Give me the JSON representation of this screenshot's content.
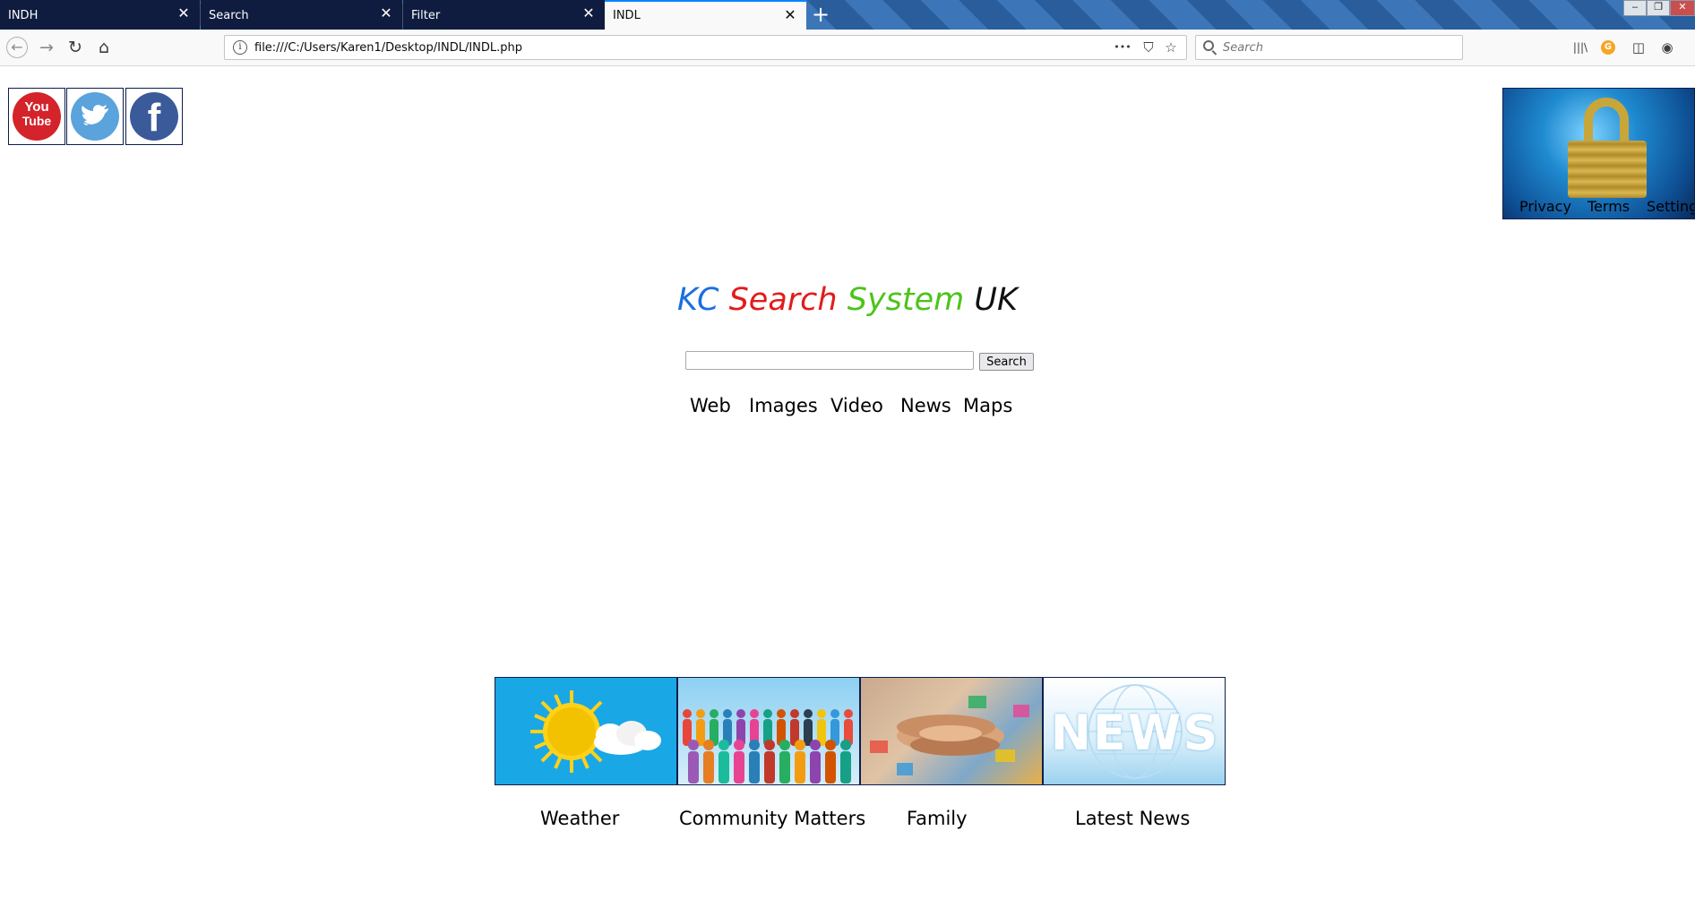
{
  "tabs": [
    {
      "label": "INDH",
      "close": "✕"
    },
    {
      "label": "Search",
      "close": "✕"
    },
    {
      "label": "Filter",
      "close": "✕"
    },
    {
      "label": "INDL",
      "close": "✕"
    }
  ],
  "new_tab": "+",
  "window_controls": {
    "minimize": "–",
    "restore": "❐",
    "close": "✕"
  },
  "nav": {
    "back": "←",
    "forward": "→",
    "reload": "↻",
    "home": "⌂"
  },
  "address_bar": {
    "info": "i",
    "url": "file:///C:/Users/Karen1/Desktop/INDL/INDL.php",
    "more": "•••",
    "pocket": "⛉",
    "bookmark": "☆"
  },
  "search_bar": {
    "placeholder": "Search"
  },
  "toolbar_icons": {
    "library": "|||\\",
    "extension": "G",
    "sidebar": "◫",
    "account": "◉"
  },
  "social": {
    "youtube": {
      "line1": "You",
      "line2": "Tube",
      "color": "#d4232a"
    },
    "twitter": {
      "glyph": "🐦",
      "color": "#5aa3dc"
    },
    "facebook": {
      "glyph": "f",
      "color": "#3b5a9a"
    }
  },
  "lock_links": [
    "Privacy",
    "Terms",
    "Settings"
  ],
  "brand": {
    "words": [
      "KC",
      "Search",
      "System",
      "UK"
    ],
    "colors": [
      "#1a6fe0",
      "#e31b1b",
      "#4cc41a",
      "#111111"
    ]
  },
  "search": {
    "value": "",
    "button": "Search"
  },
  "verticals": [
    "Web",
    "Images",
    "Video",
    "News",
    "Maps"
  ],
  "tiles": [
    {
      "label": "Weather"
    },
    {
      "label": "Community Matters"
    },
    {
      "label": "Family"
    },
    {
      "label": "Latest News",
      "image_text": "NEWS"
    }
  ]
}
